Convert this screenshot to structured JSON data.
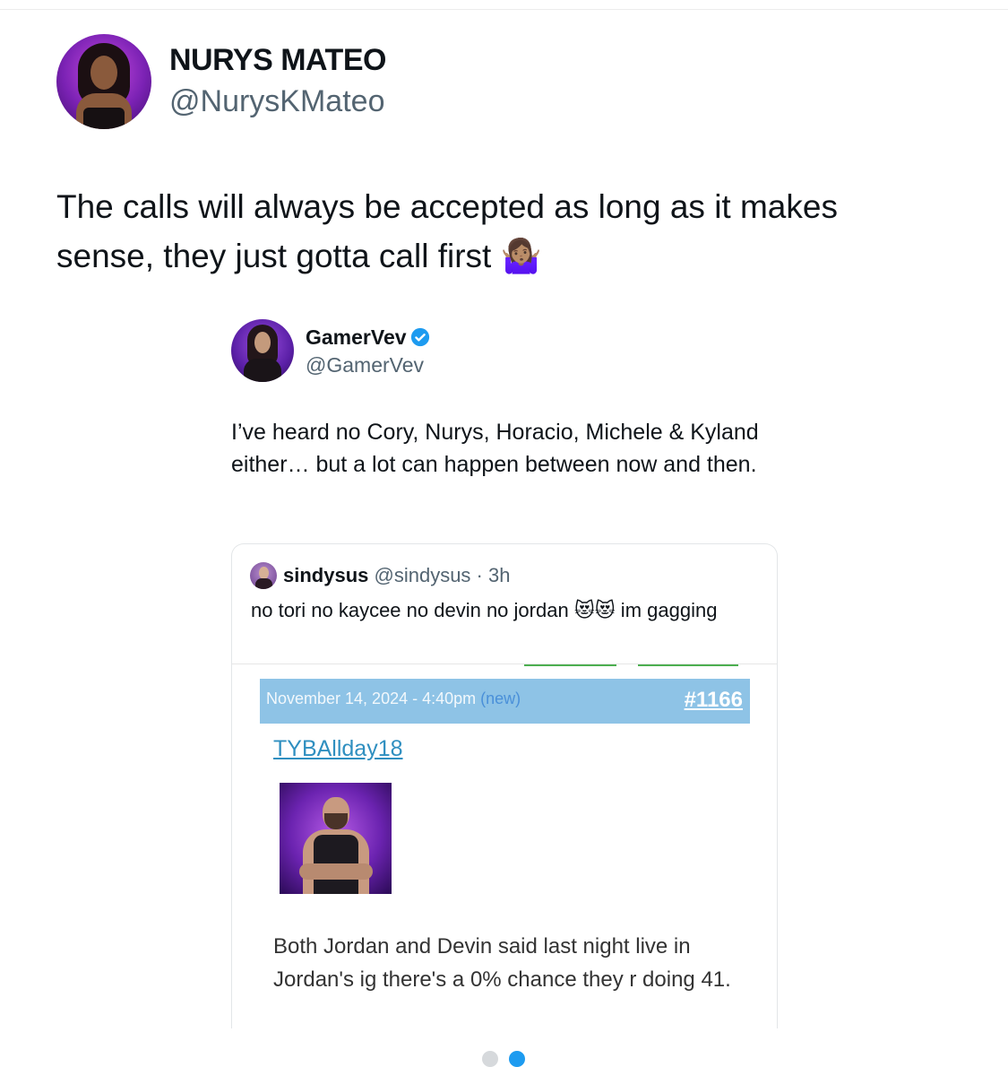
{
  "post": {
    "author_name": "NURYS MATEO",
    "author_handle": "@NurysKMateo",
    "text": "The calls will always be accepted as long as it makes sense, they just gotta call first",
    "emoji": "🤷🏽‍♀️"
  },
  "quoted": {
    "author_name": "GamerVev",
    "author_handle": "@GamerVev",
    "verified": true,
    "text": "I’ve heard no Cory, Nurys, Horacio, Michele & Kyland either… but a lot can happen between now and then."
  },
  "nested": {
    "author_name": "sindysus",
    "author_handle": "@sindysus",
    "separator": " · ",
    "time": "3h",
    "text_before": "no tori no kaycee no devin no jordan ",
    "emoji": "😻😻",
    "text_after": " im gagging"
  },
  "forum": {
    "date": "November 14, 2024 - 4:40pm ",
    "new_label": "(new)",
    "post_number": "#1166",
    "username": "TYBAllday18",
    "body": "Both Jordan and Devin said last night live in Jordan's ig there's a 0% chance they r doing 41."
  },
  "pagination": {
    "total": 2,
    "active": 2
  },
  "colors": {
    "accent": "#1d9bf0",
    "forum_bar": "#8ec3e6",
    "link": "#2f8fc0"
  }
}
